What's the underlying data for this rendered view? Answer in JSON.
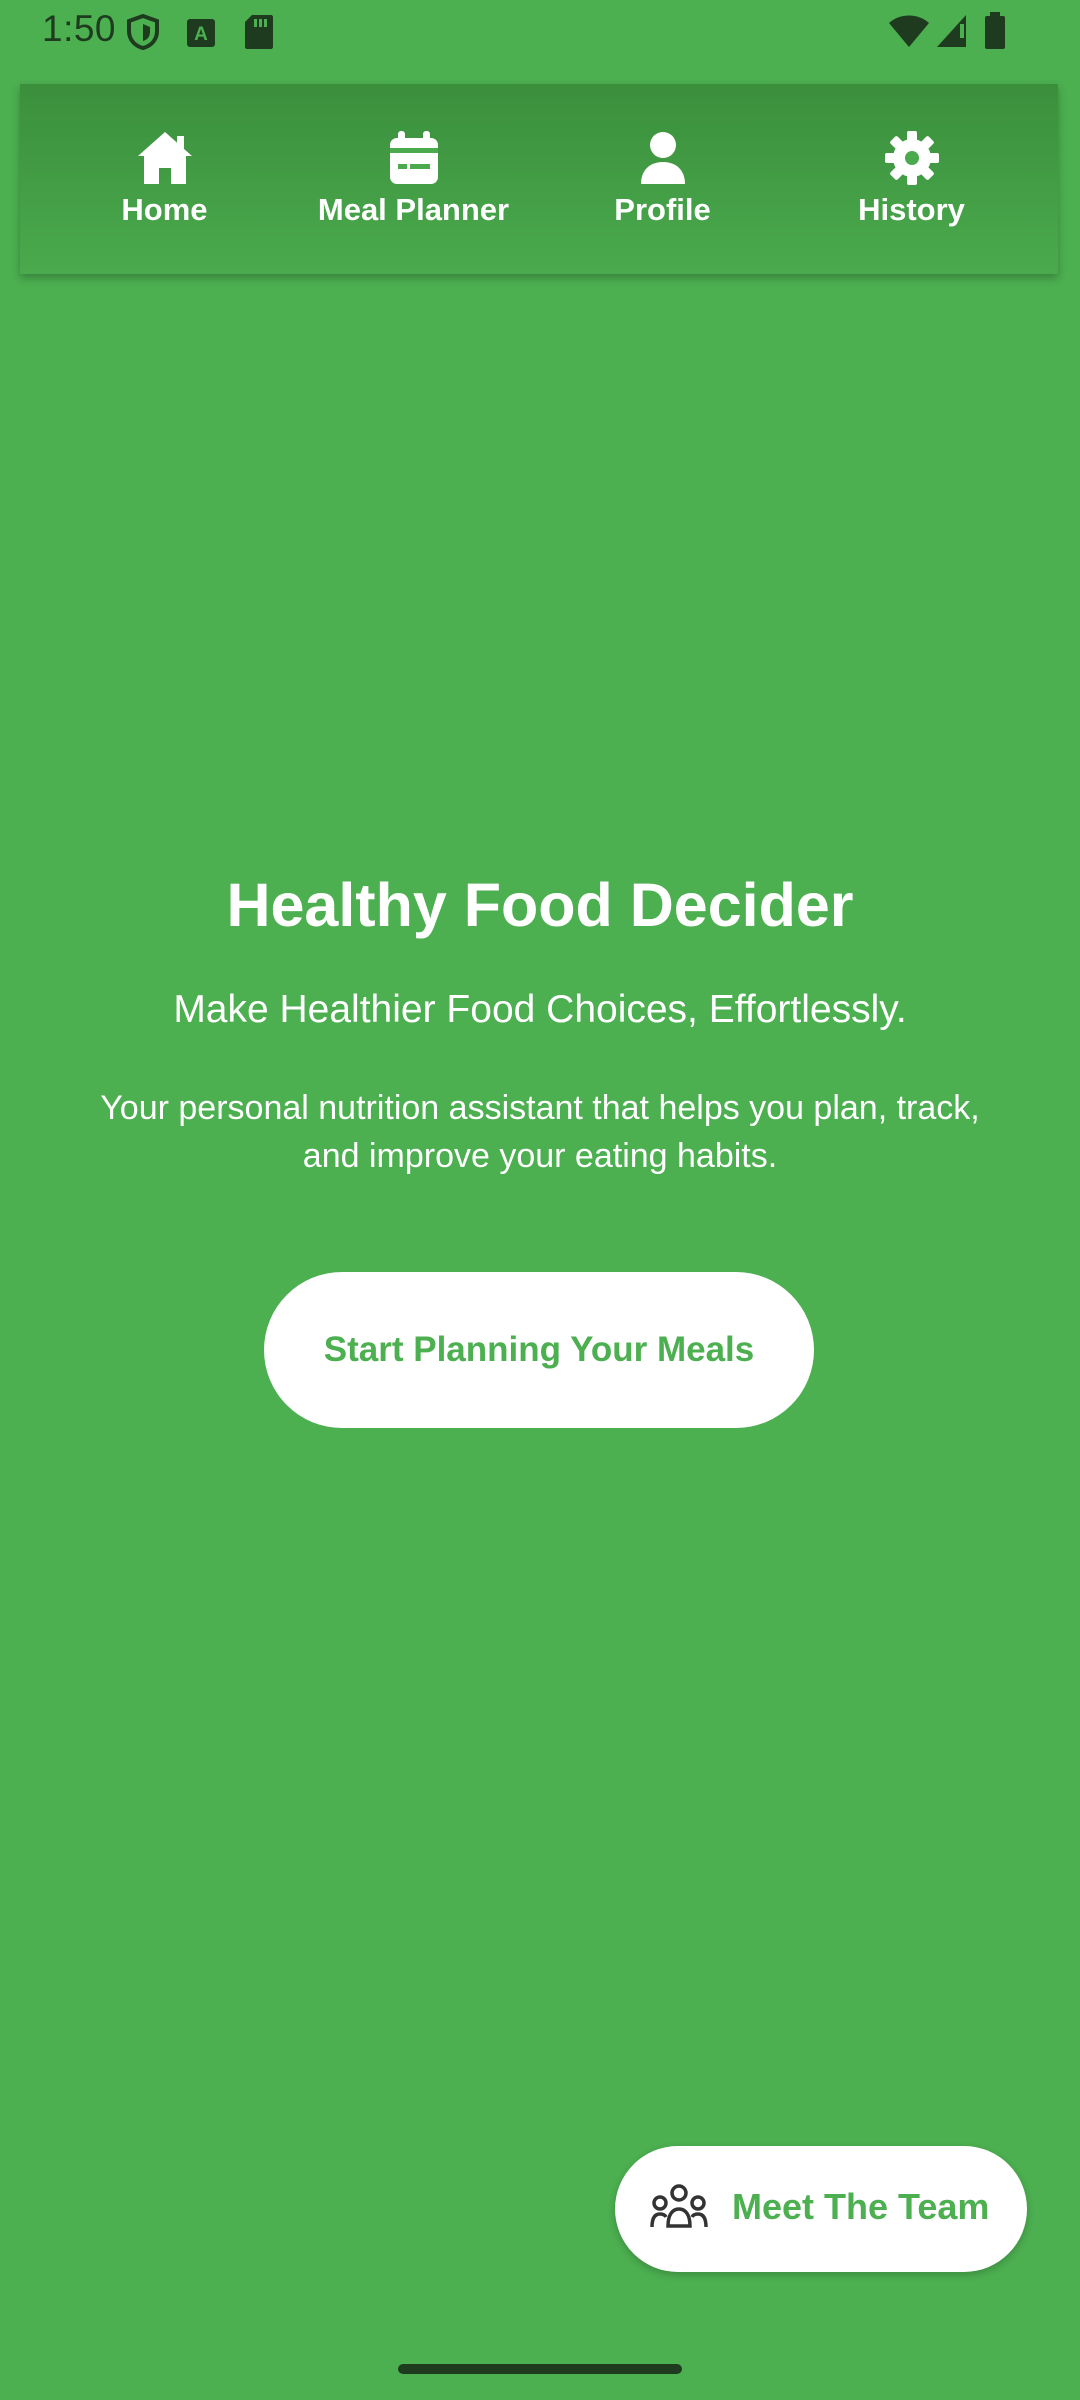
{
  "status_bar": {
    "time": "1:50",
    "icons": [
      "shield-icon",
      "a-icon",
      "sd-card-icon",
      "wifi-icon",
      "signal-icon",
      "battery-icon"
    ]
  },
  "nav": {
    "items": [
      {
        "label": "Home",
        "icon": "home-icon"
      },
      {
        "label": "Meal Planner",
        "icon": "calendar-icon"
      },
      {
        "label": "Profile",
        "icon": "person-icon"
      },
      {
        "label": "History",
        "icon": "gear-icon"
      }
    ]
  },
  "hero": {
    "title": "Healthy Food Decider",
    "subtitle": "Make Healthier Food Choices, Effortlessly.",
    "description": "Your personal nutrition assistant that helps you plan, track, and improve your eating habits.",
    "cta_label": "Start Planning Your Meals"
  },
  "team_button": {
    "label": "Meet The Team",
    "icon": "team-icon"
  },
  "colors": {
    "background": "#4CAF50",
    "accent": "#4CAF50",
    "nav_dark": "#3b8f3c",
    "text": "#ffffff",
    "status_text": "#1f3b1f"
  }
}
